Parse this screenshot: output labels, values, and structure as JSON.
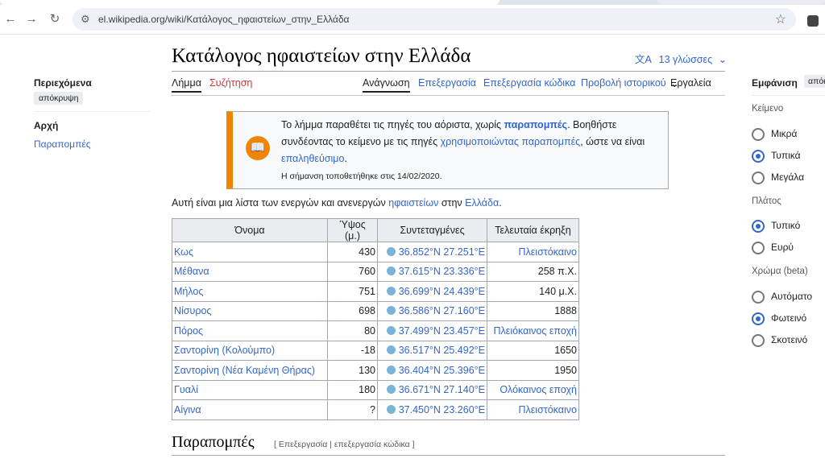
{
  "browser": {
    "url": "el.wikipedia.org/wiki/Κατάλογος_ηφαιστείων_στην_Ελλάδα"
  },
  "article": {
    "title": "Κατάλογος ηφαιστείων στην Ελλάδα",
    "languages": "13 γλώσσες",
    "tabs_left": [
      "Λήμμα",
      "Συζήτηση"
    ],
    "tabs_right": [
      "Ανάγνωση",
      "Επεξεργασία",
      "Επεξεργασία κώδικα",
      "Προβολή ιστορικού",
      "Εργαλεία"
    ]
  },
  "toc": {
    "heading": "Περιεχόμενα",
    "hide": "απόκρυψη",
    "items": [
      "Αρχή",
      "Παραπομπές"
    ]
  },
  "notice": {
    "t1": "Το λήμμα παραθέτει τις πηγές του αόριστα, χωρίς ",
    "l1": "παραπομπές",
    "t2": ". Βοηθήστε συνδέοντας το κείμενο με τις πηγές ",
    "l2": "χρησιμοποιώντας παραπομπές",
    "t3": ", ώστε να είναι ",
    "l3": "επαληθεύσιμο",
    "t4": ".",
    "date": "Η σήμανση τοποθετήθηκε στις 14/02/2020."
  },
  "intro": {
    "t1": "Αυτή είναι μια λίστα των ενεργών και ανενεργών ",
    "l1": "ηφαιστείων",
    "t2": " στην ",
    "l2": "Ελλάδα",
    "t3": "."
  },
  "table": {
    "headers": [
      "Όνομα",
      "Ύψος (μ.)",
      "Συντεταγμένες",
      "Τελευταία έκρηξη"
    ],
    "rows": [
      {
        "name": "Κως",
        "height": "430",
        "coords": "36.852°N 27.251°E",
        "eruption": "Πλειστόκαινο"
      },
      {
        "name": "Μέθανα",
        "height": "760",
        "coords": "37.615°N 23.336°E",
        "eruption": "258 π.Χ."
      },
      {
        "name": "Μήλος",
        "height": "751",
        "coords": "36.699°N 24.439°E",
        "eruption": "140 μ.Χ."
      },
      {
        "name": "Νίσυρος",
        "height": "698",
        "coords": "36.586°N 27.160°E",
        "eruption": "1888"
      },
      {
        "name": "Πόρος",
        "height": "80",
        "coords": "37.499°N 23.457°E",
        "eruption": "Πλειόκαινος εποχή"
      },
      {
        "name": "Σαντορίνη (Κολούμπο)",
        "height": "-18",
        "coords": "36.517°N 25.492°E",
        "eruption": "1650"
      },
      {
        "name": "Σαντορίνη (Νέα Καμένη Θήρας)",
        "height": "130",
        "coords": "36.404°N 25.396°E",
        "eruption": "1950"
      },
      {
        "name": "Γυαλί",
        "height": "180",
        "coords": "36.671°N 27.140°E",
        "eruption": "Ολόκαινος εποχή"
      },
      {
        "name": "Αίγινα",
        "height": "?",
        "coords": "37.450°N 23.260°E",
        "eruption": "Πλειστόκαινο"
      }
    ]
  },
  "section": {
    "title": "Παραπομπές",
    "edit": "[ Επεξεργασία | επεξεργασία κώδικα ]"
  },
  "appearance": {
    "title": "Εμφάνιση",
    "hide": "απόκ",
    "text_group": "Κείμενο",
    "text_options": [
      "Μικρά",
      "Τυπικά",
      "Μεγάλα"
    ],
    "width_group": "Πλάτος",
    "width_options": [
      "Τυπικό",
      "Ευρύ"
    ],
    "color_group": "Χρώμα (beta)",
    "color_options": [
      "Αυτόματο",
      "Φωτεινό",
      "Σκοτεινό"
    ]
  }
}
